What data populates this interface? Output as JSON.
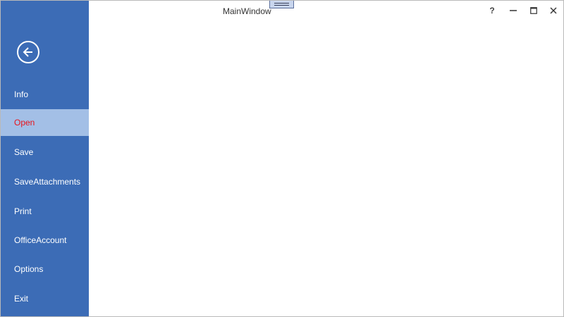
{
  "window": {
    "title": "MainWindow"
  },
  "caption_buttons": {
    "help": "?",
    "minimize_icon": "minimize-icon",
    "maximize_icon": "maximize-icon",
    "close_icon": "close-icon"
  },
  "sidebar": {
    "back_icon": "arrow-left-circle-icon",
    "items": [
      {
        "label": "Info",
        "selected": false
      },
      {
        "label": "Open",
        "selected": true
      },
      {
        "label": "Save",
        "selected": false
      },
      {
        "label": "SaveAttachments",
        "selected": false
      },
      {
        "label": "Print",
        "selected": false
      },
      {
        "label": "OfficeAccount",
        "selected": false
      },
      {
        "label": "Options",
        "selected": false
      },
      {
        "label": "Exit",
        "selected": false
      }
    ]
  },
  "colors": {
    "sidebar_bg": "#3c6cb6",
    "selected_bg": "#a3bfe6",
    "selected_text": "#e8141c"
  }
}
